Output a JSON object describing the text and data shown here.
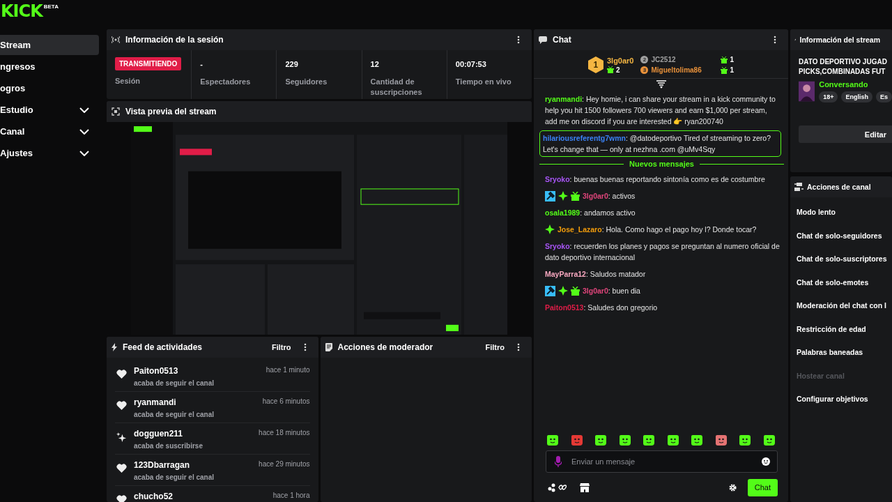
{
  "logo": {
    "text": "KICK",
    "badge": "BETA"
  },
  "sidebar": {
    "items": [
      {
        "label": "Stream",
        "selected": true,
        "expandable": false
      },
      {
        "label": "ngresos",
        "selected": false,
        "expandable": false
      },
      {
        "label": "ogros",
        "selected": false,
        "expandable": false
      },
      {
        "label": "Estudio",
        "selected": false,
        "expandable": true
      },
      {
        "label": "Canal",
        "selected": false,
        "expandable": true
      },
      {
        "label": "Ajustes",
        "selected": false,
        "expandable": true
      }
    ]
  },
  "session": {
    "title": "Información de la sesión",
    "stats": [
      {
        "kind": "badge",
        "value": "TRANSMITIENDO",
        "label": "Sesión"
      },
      {
        "kind": "number",
        "value": "-",
        "label": "Espectadores"
      },
      {
        "kind": "number",
        "value": "229",
        "label": "Seguidores"
      },
      {
        "kind": "number",
        "value": "12",
        "label": "Cantidad de suscripciones"
      },
      {
        "kind": "number",
        "value": "00:07:53",
        "label": "Tiempo en vivo"
      }
    ]
  },
  "preview": {
    "title": "Vista previa del stream",
    "kind": "picture"
  },
  "feed": {
    "title": "Feed de actividades",
    "filter": "Filtro",
    "items": [
      {
        "kind": "follow",
        "name": "Paiton0513",
        "time": "hace 1 minuto",
        "text": "acaba de seguir el canal"
      },
      {
        "kind": "follow",
        "name": "ryanmandi",
        "time": "hace 6 minutos",
        "text": "acaba de seguir el canal"
      },
      {
        "kind": "subscribe",
        "name": "dogguen211",
        "time": "hace 18 minutos",
        "text": "acaba de suscribirse"
      },
      {
        "kind": "follow",
        "name": "123Dbarragan",
        "time": "hace 29 minutos",
        "text": "acaba de seguir el canal"
      },
      {
        "kind": "follow",
        "name": "chucho52",
        "time": "hace 1 hora"
      }
    ]
  },
  "moderator": {
    "title": "Acciones de moderador",
    "filter": "Filtro"
  },
  "chat": {
    "title": "Chat",
    "leaders": [
      {
        "rank": "1",
        "name": "3lg0ar0",
        "gifts": "2",
        "color": "#f5b642"
      },
      {
        "rank": "2",
        "name": "JC2512",
        "gifts": "1",
        "color": "#a0a0a0"
      },
      {
        "rank": "3",
        "name": "Migueltolima86",
        "gifts": "1",
        "color": "#e8913a"
      }
    ],
    "messages_before": [
      {
        "user": "ryanmandi",
        "color": "#53fc18",
        "text": ": Hey homie, i can share your stream in a kick community to help you hit 1500 followers 700 viewers and earn $1,000 per stream, add me on discord if you are interested 👉  ryan200740",
        "highlighted": false
      },
      {
        "user": "hilariousreferentg7wmn",
        "color": "#3b82f6",
        "text": ": @datodeportivo Tired of streaming to zero? Let's change that — only at nezhna .com @uMv4Sqy",
        "highlighted": true
      }
    ],
    "divider": "Nuevos mensajes",
    "messages": [
      {
        "user": "Sryoko",
        "color": "#a855f7",
        "text": ": buenas buenas reportando sintonía como es de costumbre",
        "highlighted": false
      },
      {
        "user": "3lg0ar0",
        "color": "#e0457b",
        "text": ": activos",
        "badges": [
          {
            "kind": "moderator"
          },
          {
            "kind": "verified"
          },
          {
            "kind": "gift"
          }
        ],
        "highlighted": false
      },
      {
        "user": "osala1989",
        "color": "#53fc18",
        "text": ": andamos activo",
        "highlighted": false
      },
      {
        "user": "Jose_Lazaro",
        "color": "#f59e0b",
        "text": ": Hola. Como hago el pago hoy l? Donde tocar?",
        "badges": [
          {
            "kind": "verified"
          }
        ],
        "highlighted": false
      },
      {
        "user": "Sryoko",
        "color": "#a855f7",
        "text": ": recuerden los planes y pagos se preguntan al numero oficial de dato deportivo internacional",
        "highlighted": false
      },
      {
        "user": "MayParra12",
        "color": "#f9a8c0",
        "text": ": Saludos matador",
        "highlighted": false
      },
      {
        "user": "3lg0ar0",
        "color": "#e0457b",
        "text": ": buen dia",
        "badges": [
          {
            "kind": "moderator"
          },
          {
            "kind": "verified"
          },
          {
            "kind": "gift"
          }
        ],
        "highlighted": false
      },
      {
        "user": "Paiton0513",
        "color": "#e11d48",
        "text": ": Saludes don gregorio",
        "highlighted": false
      }
    ],
    "emotes": [
      {
        "color": "#53fc18"
      },
      {
        "color": "#e53935"
      },
      {
        "color": "#53fc18"
      },
      {
        "color": "#53fc18"
      },
      {
        "color": "#53fc18"
      },
      {
        "color": "#53fc18"
      },
      {
        "color": "#53fc18"
      },
      {
        "color": "#e57373"
      },
      {
        "color": "#53fc18"
      },
      {
        "color": "#53fc18"
      }
    ],
    "input": {
      "placeholder": "Enviar un mensaje"
    },
    "send": "Chat"
  },
  "stream_info": {
    "title": "Información del stream",
    "stream_title": [
      "DATO DEPORTIVO JUGAD",
      "PICKS,COMBINADAS FUT"
    ],
    "category": "Conversando",
    "tags": [
      "18+",
      "English",
      "Es"
    ],
    "edit": "Editar"
  },
  "channel_actions": {
    "title": "Acciones de canal",
    "items": [
      {
        "label": "Modo lento",
        "disabled": false
      },
      {
        "label": "Chat de solo-seguidores",
        "disabled": false
      },
      {
        "label": "Chat de solo-suscriptores",
        "disabled": false
      },
      {
        "label": "Chat de solo-emotes",
        "disabled": false
      },
      {
        "label": "Moderación del chat con I",
        "disabled": false
      },
      {
        "label": "Restricción de edad",
        "disabled": false
      },
      {
        "label": "Palabras baneadas",
        "disabled": false
      },
      {
        "label": "Hostear canal",
        "disabled": true
      },
      {
        "label": "Configurar objetivos",
        "disabled": false
      }
    ]
  }
}
